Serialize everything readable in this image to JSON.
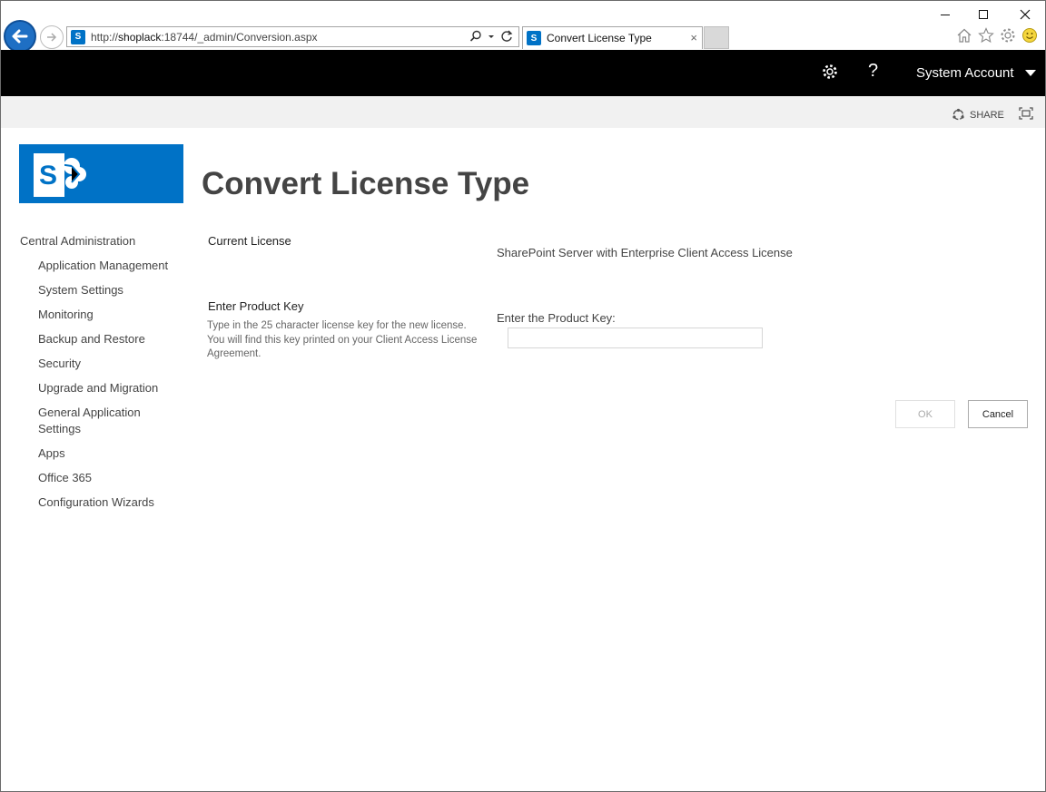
{
  "browser": {
    "url_prefix": "http://",
    "url_host": "shoplack",
    "url_rest": ":18744/_admin/Conversion.aspx",
    "tab_title": "Convert License Type",
    "tab_close": "×",
    "favicon_letter": "S"
  },
  "suite": {
    "help": "?",
    "user": "System Account"
  },
  "ribbon": {
    "share": "SHARE"
  },
  "page": {
    "title": "Convert License Type"
  },
  "quicklaunch": {
    "root": "Central Administration",
    "items": [
      {
        "label": "Application Management"
      },
      {
        "label": "System Settings"
      },
      {
        "label": "Monitoring"
      },
      {
        "label": "Backup and Restore"
      },
      {
        "label": "Security"
      },
      {
        "label": "Upgrade and Migration"
      },
      {
        "label": "General Application Settings"
      },
      {
        "label": "Apps"
      },
      {
        "label": "Office 365"
      },
      {
        "label": "Configuration Wizards"
      }
    ]
  },
  "form": {
    "current_license_title": "Current License",
    "current_license_value": "SharePoint Server with Enterprise Client Access License",
    "product_key_title": "Enter Product Key",
    "product_key_desc": "Type in the 25 character license key for the new license. You will find this key printed on your Client Access License Agreement.",
    "product_key_label": "Enter the Product Key:",
    "product_key_value": "",
    "ok_label": "OK",
    "cancel_label": "Cancel"
  },
  "colors": {
    "brand": "#0072c6",
    "suitebar": "#000000",
    "ribbon": "#f1f1f1"
  }
}
